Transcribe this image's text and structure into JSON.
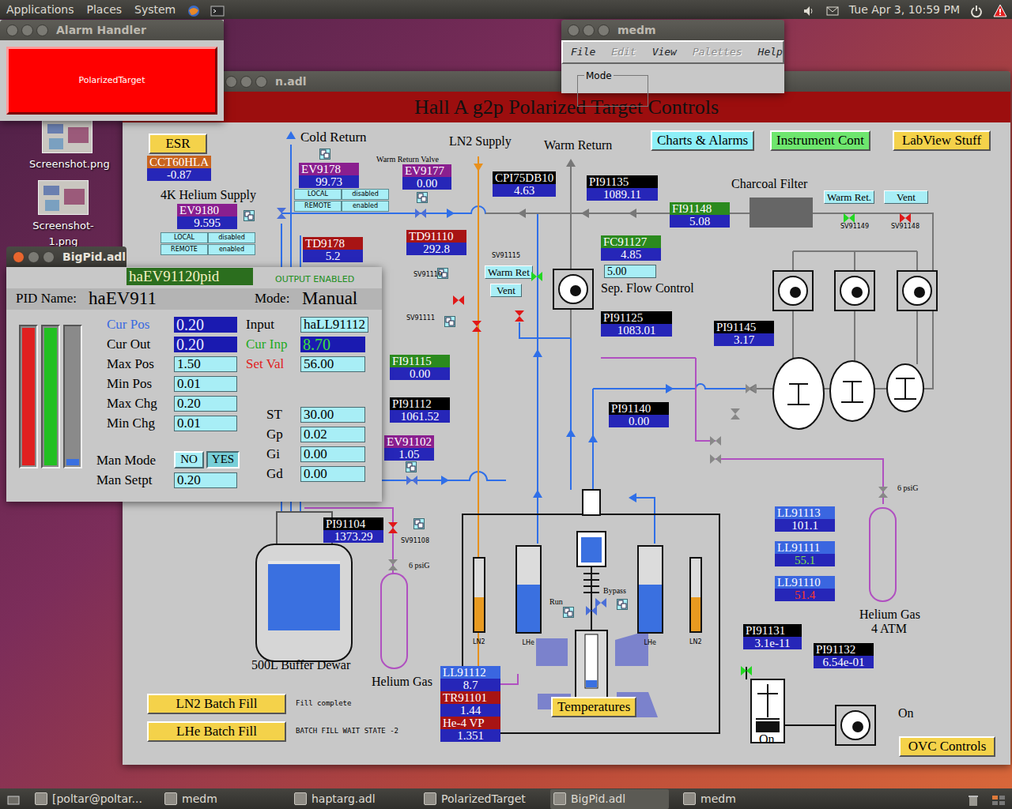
{
  "top_panel": {
    "menus": [
      {
        "label": "Applications"
      },
      {
        "label": "Places"
      },
      {
        "label": "System"
      }
    ],
    "clock": "Tue Apr 3, 10:59 PM"
  },
  "desktop_icons": [
    {
      "label": "Screenshot.png"
    },
    {
      "label": "Screenshot-1.png"
    }
  ],
  "alarm_handler": {
    "title": "Alarm Handler",
    "button": "PolarizedTarget",
    "in_alarm": true
  },
  "medm_window": {
    "title": "medm",
    "menu": [
      {
        "label": "File",
        "disabled": false
      },
      {
        "label": "Edit",
        "disabled": true
      },
      {
        "label": "View",
        "disabled": false
      },
      {
        "label": "Palettes",
        "disabled": true
      },
      {
        "label": "Help",
        "disabled": false
      }
    ],
    "group_label": "Mode"
  },
  "target_window": {
    "title": "n.adl",
    "heading": "Hall A g2p Polarized Target Controls",
    "buttons": [
      {
        "label": "ESR",
        "kind": "yellow"
      },
      {
        "label": "Charts & Alarms",
        "kind": "cyan"
      },
      {
        "label": "Instrument Cont",
        "kind": "green"
      },
      {
        "label": "LabView Stuff",
        "kind": "yellow"
      },
      {
        "label": "LN2 Batch Fill",
        "kind": "yellow"
      },
      {
        "label": "LHe Batch Fill",
        "kind": "yellow"
      },
      {
        "label": "Temperatures",
        "kind": "yellow"
      },
      {
        "label": "OVC Controls",
        "kind": "yellow"
      }
    ],
    "small_buttons": [
      {
        "label": "Warm Ret."
      },
      {
        "label": "Vent"
      },
      {
        "label": "Warm Ret"
      },
      {
        "label": "Vent"
      }
    ],
    "access_toggles": [
      {
        "cells": [
          {
            "label": "LOCAL"
          },
          {
            "label": "disabled"
          },
          {
            "label": "REMOTE"
          },
          {
            "label": "enabled"
          }
        ]
      },
      {
        "cells": [
          {
            "label": "LOCAL"
          },
          {
            "label": "disabled"
          },
          {
            "label": "REMOTE"
          },
          {
            "label": "enabled"
          }
        ]
      }
    ],
    "readouts": [
      {
        "label": "CCT60HLA",
        "value": "-0.87",
        "color": "#c8641e",
        "value_color": "#ffffff"
      },
      {
        "label": "EV9178",
        "value": "99.73",
        "color": "#8a1f8f",
        "value_color": "#ffffff"
      },
      {
        "label": "EV9177",
        "value": "0.00",
        "color": "#8a1f8f",
        "value_color": "#ffffff"
      },
      {
        "label": "EV9180",
        "value": "9.595",
        "color": "#8a1f8f",
        "value_color": "#ffffff"
      },
      {
        "label": "TD9178",
        "value": "5.2",
        "color": "#a81414",
        "value_color": "#ffffff"
      },
      {
        "label": "TD91110",
        "value": "292.8",
        "color": "#a81414",
        "value_color": "#ffffff"
      },
      {
        "label": "CPI75DB10",
        "value": "4.63",
        "color": "#000000",
        "value_color": "#ffffff"
      },
      {
        "label": "PI91135",
        "value": "1089.11",
        "color": "#000000",
        "value_color": "#ffffff"
      },
      {
        "label": "FI91148",
        "value": "5.08",
        "color": "#2b8a1e",
        "value_color": "#ffffff"
      },
      {
        "label": "FC91127",
        "value": "4.85",
        "color": "#2b8a1e",
        "value_color": "#ffffff"
      },
      {
        "label": "PI91125",
        "value": "1083.01",
        "color": "#000000",
        "value_color": "#ffffff"
      },
      {
        "label": "PI91145",
        "value": "3.17",
        "color": "#000000",
        "value_color": "#ffffff"
      },
      {
        "label": "FI91115",
        "value": "0.00",
        "color": "#2b8a1e",
        "value_color": "#ffffff"
      },
      {
        "label": "PI91112",
        "value": "1061.52",
        "color": "#000000",
        "value_color": "#ffffff"
      },
      {
        "label": "PI91140",
        "value": "0.00",
        "color": "#000000",
        "value_color": "#ffffff"
      },
      {
        "label": "EV91102",
        "value": "1.05",
        "color": "#8a1f8f",
        "value_color": "#ffffff"
      },
      {
        "label": "PI91104",
        "value": "1373.29",
        "color": "#000000",
        "value_color": "#ffffff"
      },
      {
        "label": "LL91113",
        "value": "101.1",
        "color": "#3a66e0",
        "value_color": "#ffffff"
      },
      {
        "label": "LL91111",
        "value": "55.1",
        "color": "#3a66e0",
        "value_color": "#7ee04a"
      },
      {
        "label": "LL91110",
        "value": "51.4",
        "color": "#3a66e0",
        "value_color": "#ff3a2a"
      },
      {
        "label": "LL91112",
        "value": "8.7",
        "color": "#3a66e0",
        "value_color": "#ffffff"
      },
      {
        "label": "TR91101",
        "value": "1.44",
        "color": "#a81414",
        "value_color": "#ffffff"
      },
      {
        "label": "He-4 VP",
        "value": "1.351",
        "color": "#a81414",
        "value_color": "#ffffff"
      },
      {
        "label": "PI91131",
        "value": "3.1e-11",
        "color": "#000000",
        "value_color": "#ffffff"
      },
      {
        "label": "PI91132",
        "value": "6.54e-01",
        "color": "#000000",
        "value_color": "#ffffff"
      }
    ],
    "setpoint": {
      "value": "5.00"
    },
    "labels": [
      {
        "text": "Cold Return"
      },
      {
        "text": "LN2 Supply"
      },
      {
        "text": "Warm Return"
      },
      {
        "text": "Warm Return Valve"
      },
      {
        "text": "4K Helium Supply"
      },
      {
        "text": "Charcoal Filter"
      },
      {
        "text": "Sep. Flow Control"
      },
      {
        "text": "Helium Gas"
      },
      {
        "text": "Helium Gas"
      },
      {
        "text": "4 ATM"
      },
      {
        "text": "Run"
      },
      {
        "text": "Bypass"
      },
      {
        "text": "6 psiG"
      },
      {
        "text": "6 psiG"
      },
      {
        "text": "On"
      },
      {
        "text": "On"
      }
    ],
    "valves": [
      {
        "label": "SV91149",
        "open": true
      },
      {
        "label": "SV91148",
        "open": false
      },
      {
        "label": "SV91115",
        "open": true
      },
      {
        "label": "SV91110",
        "open": false
      },
      {
        "label": "SV91111",
        "open": false
      },
      {
        "label": "SV91108",
        "open": false
      }
    ],
    "unlabeled_valves": [
      {
        "open": false
      },
      {
        "open": true
      }
    ],
    "level_tubes": [
      {
        "label": "LN2",
        "level": 0.47,
        "color": "#e89a20"
      },
      {
        "label": "LHe",
        "level": 0.56,
        "color": "#3a70e0"
      },
      {
        "label": "LHe",
        "level": 0.56,
        "color": "#3a70e0"
      },
      {
        "label": "LN2",
        "level": 0.47,
        "color": "#e89a20"
      }
    ],
    "buffer_dewar": {
      "label": "500L Buffer Dewar",
      "level": 0.95
    },
    "status_texts": [
      {
        "text": "Fill complete"
      },
      {
        "text": "BATCH FILL WAIT STATE -2"
      }
    ]
  },
  "pid_window": {
    "title": "BigPid.adl",
    "record": "haEV91120pid",
    "output_status": "OUTPUT ENABLED",
    "name_label": "PID Name:",
    "name": "haEV911",
    "mode_label": "Mode:",
    "mode": "Manual",
    "bars": [
      {
        "color": "#e02020",
        "level": 1
      },
      {
        "color": "#22c022",
        "level": 1
      },
      {
        "color": "#3a70e0",
        "level": 0.07
      }
    ],
    "left_fields": [
      {
        "label": "Cur Pos",
        "value": "0.20",
        "kind": "readback",
        "color": "#3a6ae0",
        "value_color": "#e8e8ff"
      },
      {
        "label": "Cur Out",
        "value": "0.20",
        "kind": "readback",
        "color": "#000000",
        "value_color": "#e8e8ff"
      },
      {
        "label": "Max Pos",
        "value": "1.50",
        "kind": "entry",
        "color": "#000000"
      },
      {
        "label": "Min Pos",
        "value": "0.01",
        "kind": "entry",
        "color": "#000000"
      },
      {
        "label": "Max Chg",
        "value": "0.20",
        "kind": "entry",
        "color": "#000000"
      },
      {
        "label": "Min Chg",
        "value": "0.01",
        "kind": "entry",
        "color": "#000000"
      }
    ],
    "right_fields": [
      {
        "label": "Input",
        "value": "haLL91112",
        "kind": "entry",
        "color": "#000000"
      },
      {
        "label": "Cur Inp",
        "value": "8.70",
        "kind": "readback",
        "color": "#1faa1f",
        "value_color": "#3ee03e"
      },
      {
        "label": "Set Val",
        "value": "56.00",
        "kind": "entry",
        "color": "#e02020"
      }
    ],
    "gains": [
      {
        "label": "ST",
        "value": "30.00"
      },
      {
        "label": "Gp",
        "value": "0.02"
      },
      {
        "label": "Gi",
        "value": "0.00"
      },
      {
        "label": "Gd",
        "value": "0.00"
      }
    ],
    "man_mode": {
      "label": "Man Mode",
      "options": [
        {
          "label": "NO",
          "selected": false
        },
        {
          "label": "YES",
          "selected": true
        }
      ]
    },
    "man_setpt": {
      "label": "Man Setpt",
      "value": "0.20"
    }
  },
  "taskbar": [
    {
      "label": "[poltar@poltar...",
      "selected": false
    },
    {
      "label": "medm",
      "selected": false
    },
    {
      "label": "haptarg.adl",
      "selected": false
    },
    {
      "label": "PolarizedTarget",
      "selected": false
    },
    {
      "label": "BigPid.adl",
      "selected": true
    },
    {
      "label": "medm",
      "selected": false
    }
  ]
}
